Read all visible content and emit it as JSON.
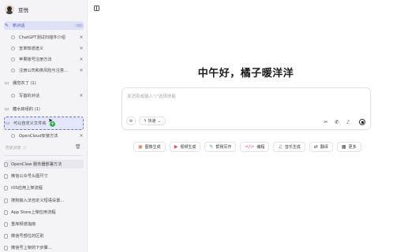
{
  "user": {
    "name": "豆悦"
  },
  "sidebar": {
    "new_chat": {
      "label": "新对话",
      "shortcut": "⌘K"
    },
    "folder1_items": [
      {
        "label": "ChatGPT测试扫插件介绍"
      },
      {
        "label": "宣率知道途义"
      },
      {
        "label": "苹果账号注册方法"
      },
      {
        "label": "注册公司和类风险与注意..."
      }
    ],
    "folder2": {
      "label": "偶觉农了 (1)"
    },
    "folder2_items": [
      {
        "label": "写首的对话"
      }
    ],
    "folder3": {
      "label": "糖水启组的 (1)"
    },
    "folder4": {
      "label": "可以自定义文件夹"
    },
    "folder4_items": [
      {
        "label": "OpenCloud安装方法"
      }
    ],
    "history_label": "历史对话",
    "history": [
      {
        "label": "OpenClaw 服务器部署方法"
      },
      {
        "label": "微信公众号头图尺寸"
      },
      {
        "label": "iOS应用上架流程"
      },
      {
        "label": "搜狗输入法自定义短语设置..."
      },
      {
        "label": "App Store上架应用流程"
      },
      {
        "label": "重库频道指南"
      },
      {
        "label": "微信号部位的区别"
      },
      {
        "label": "微信号上架的下步骤..."
      }
    ]
  },
  "main": {
    "greeting": "中午好，橘子暖洋洋",
    "composer": {
      "placeholder": "发消息或输入\"/\"选择技能",
      "quick_label": "快速"
    },
    "pills": [
      {
        "icon": "image-icon",
        "glyph": "▣",
        "color": "#e8774a",
        "label": "图像生成"
      },
      {
        "icon": "video-icon",
        "glyph": "▶",
        "color": "#e0465a",
        "label": "视频生成"
      },
      {
        "icon": "pen-icon",
        "glyph": "✎",
        "color": "#4b7bec",
        "label": "帮我写作"
      },
      {
        "icon": "code-icon",
        "glyph": "</>",
        "color": "#e05a9a",
        "label": "编程"
      },
      {
        "icon": "music-icon",
        "glyph": "♫",
        "color": "#8a55d8",
        "label": "音乐生成"
      },
      {
        "icon": "translate-icon",
        "glyph": "⇄",
        "color": "#444444",
        "label": "翻译"
      },
      {
        "icon": "more-icon",
        "glyph": "▦",
        "color": "#444444",
        "label": "更多"
      }
    ]
  }
}
